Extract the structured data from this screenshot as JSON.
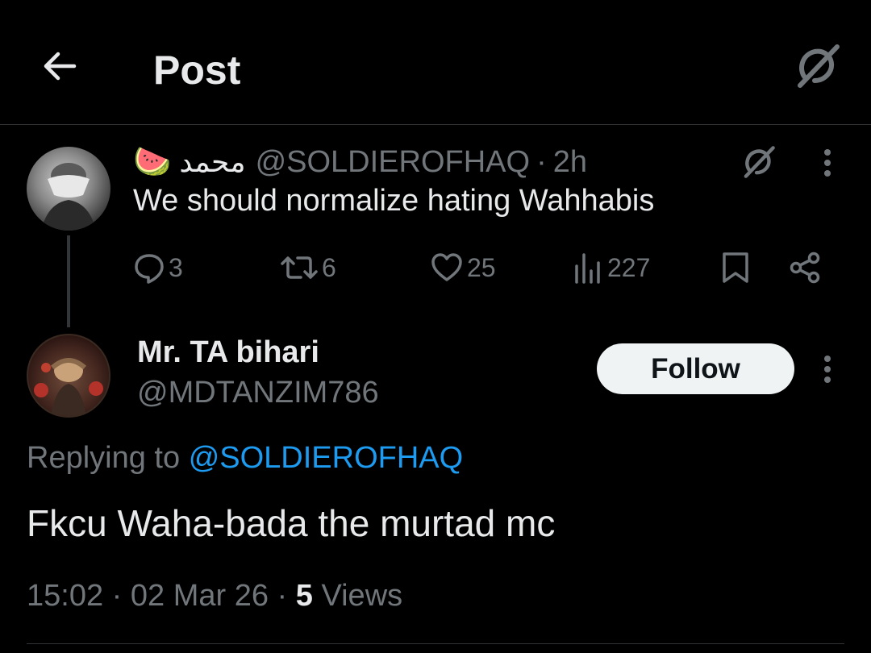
{
  "header": {
    "title": "Post",
    "icons": {
      "back": "arrow-left-icon",
      "grok": "grok-icon"
    }
  },
  "parent_tweet": {
    "emoji": "🍉",
    "display_name": "محمد",
    "handle": "@SOLDIEROFHAQ",
    "separator": "·",
    "time": "2h",
    "text": "We should normalize hating Wahhabis",
    "stats": {
      "replies": "3",
      "reposts": "6",
      "likes": "25",
      "views": "227"
    },
    "icons": {
      "reply": "reply-icon",
      "repost": "repost-icon",
      "like": "heart-icon",
      "views": "views-icon",
      "bookmark": "bookmark-icon",
      "share": "share-icon",
      "more": "more-icon"
    }
  },
  "reply_tweet": {
    "display_name": "Mr. TA bihari",
    "handle": "@MDTANZIM786",
    "follow_label": "Follow",
    "replying_prefix": "Replying to",
    "replying_mention": "@SOLDIEROFHAQ",
    "text": "Fkcu Waha-bada the murtad mc",
    "time": "15:02",
    "date": "02 Mar 26",
    "separator": "·",
    "views_count": "5",
    "views_label": "Views"
  },
  "colors": {
    "background": "#000000",
    "primary_text": "#e7e9ea",
    "secondary_text": "#71767b",
    "link": "#1d9bf0",
    "button_bg": "#eff3f4"
  }
}
